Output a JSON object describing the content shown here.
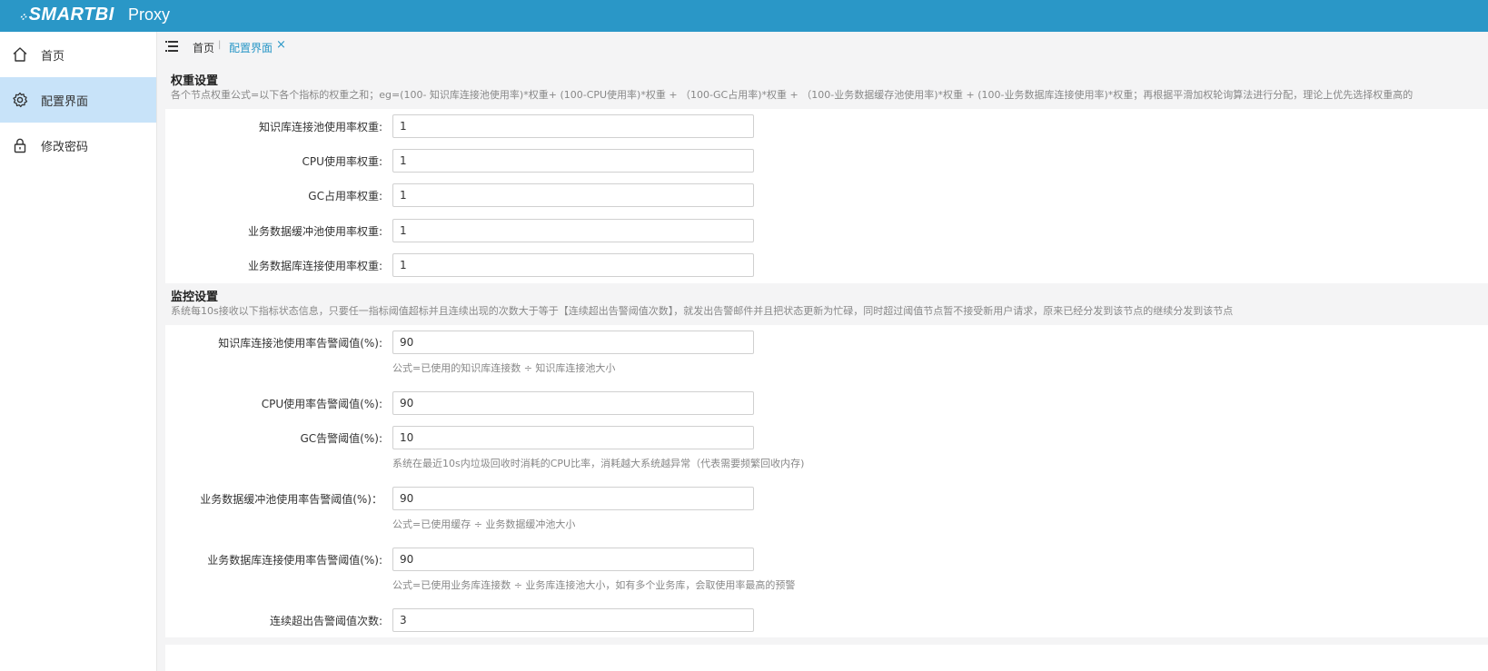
{
  "header": {
    "logo_text": "SMARTBI",
    "logo_dots": "⁘",
    "product": "Proxy",
    "bg_color": "#2a97c7"
  },
  "sidebar": {
    "items": [
      {
        "label": "首页",
        "icon": "home-icon"
      },
      {
        "label": "配置界面",
        "icon": "gear-icon",
        "active": true
      },
      {
        "label": "修改密码",
        "icon": "lock-icon"
      }
    ],
    "active_color": "#c8e3f9"
  },
  "tabs": {
    "menu_icon": "menu-toggle-icon",
    "home": "首页",
    "separator": "|",
    "current": "配置界面",
    "close": "×"
  },
  "weights": {
    "title": "权重设置",
    "desc": "各个节点权重公式=以下各个指标的权重之和；eg=(100- 知识库连接池使用率)*权重+ (100-CPU使用率)*权重 + （100-GC占用率)*权重 + （100-业务数据缓存池使用率)*权重 + (100-业务数据库连接使用率)*权重；再根据平滑加权轮询算法进行分配，理论上优先选择权重高的",
    "fields": [
      {
        "label": "知识库连接池使用率权重:",
        "value": "1"
      },
      {
        "label": "CPU使用率权重:",
        "value": "1"
      },
      {
        "label": "GC占用率权重:",
        "value": "1"
      },
      {
        "label": "业务数据缓冲池使用率权重:",
        "value": "1"
      },
      {
        "label": "业务数据库连接使用率权重:",
        "value": "1"
      }
    ]
  },
  "monitor": {
    "title": "监控设置",
    "desc": "系统每10s接收以下指标状态信息，只要任一指标阈值超标并且连续出现的次数大于等于【连续超出告警阈值次数】，就发出告警邮件并且把状态更新为忙碌，同时超过阈值节点暂不接受新用户请求，原来已经分发到该节点的继续分发到该节点",
    "fields": [
      {
        "label": "知识库连接池使用率告警阈值(%):",
        "value": "90",
        "hint": "公式=已使用的知识库连接数 ÷ 知识库连接池大小"
      },
      {
        "label": "CPU使用率告警阈值(%):",
        "value": "90",
        "hint": ""
      },
      {
        "label": "GC告警阈值(%):",
        "value": "10",
        "hint": "系统在最近10s内垃圾回收时消耗的CPU比率，消耗越大系统越异常（代表需要频繁回收内存)"
      },
      {
        "label": "业务数据缓冲池使用率告警阈值(%)：",
        "value": "90",
        "hint": "公式=已使用缓存 ÷ 业务数据缓冲池大小"
      },
      {
        "label": "业务数据库连接使用率告警阈值(%):",
        "value": "90",
        "hint": "公式=已使用业务库连接数 ÷ 业务库连接池大小，如有多个业务库，会取使用率最高的预警"
      },
      {
        "label": "连续超出告警阈值次数:",
        "value": "3",
        "hint": ""
      }
    ]
  }
}
